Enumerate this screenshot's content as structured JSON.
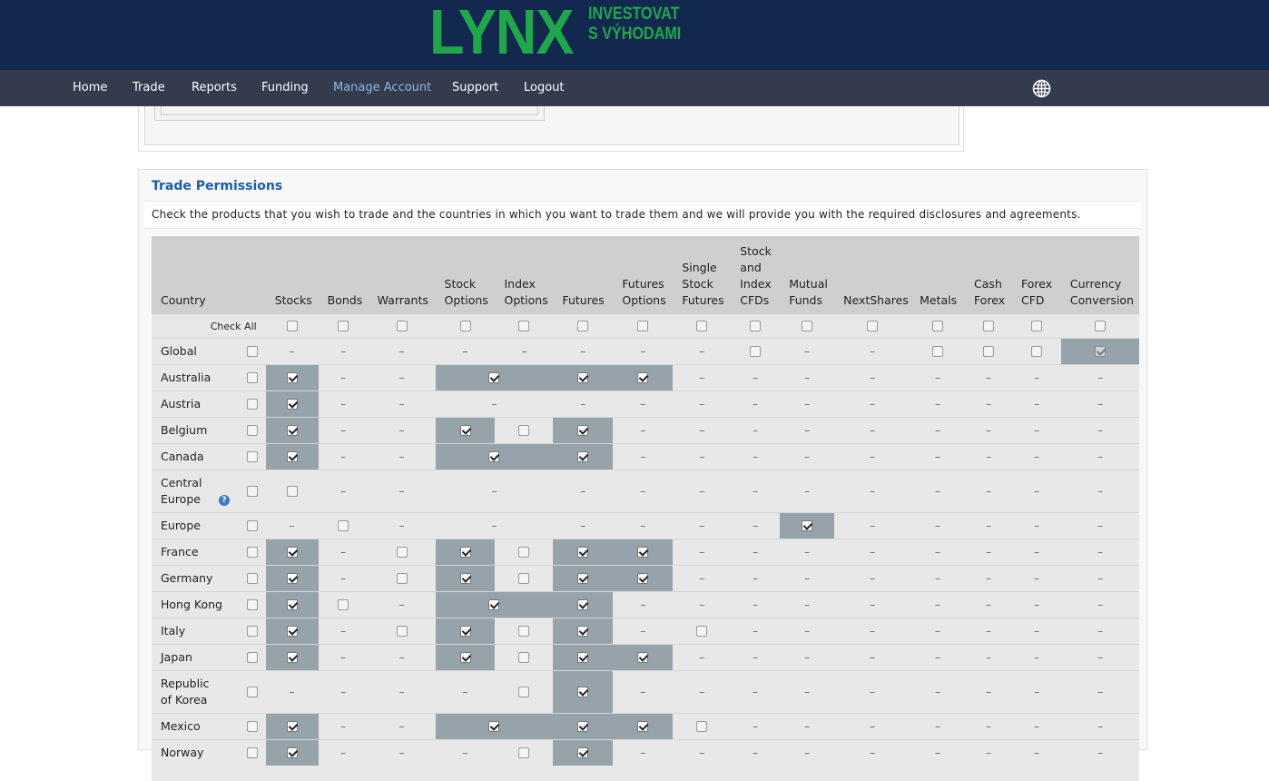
{
  "logo": {
    "mark": "LYNX",
    "tagline_line1": "INVESTOVAT",
    "tagline_line2": "S VÝHODAMI"
  },
  "nav": {
    "items": [
      "Home",
      "Trade",
      "Reports",
      "Funding",
      "Manage Account",
      "Support",
      "Logout"
    ],
    "active": "Manage Account"
  },
  "trade_permissions": {
    "title": "Trade Permissions",
    "description": "Check the products that you wish to trade and the countries in which you want to trade them and we will provide you with the required disclosures and agreements.",
    "columns": [
      {
        "key": "country",
        "label": [
          "Country"
        ]
      },
      {
        "key": "stocks",
        "label": [
          "Stocks"
        ]
      },
      {
        "key": "bonds",
        "label": [
          "Bonds"
        ]
      },
      {
        "key": "warrants",
        "label": [
          "Warrants"
        ]
      },
      {
        "key": "stock_options",
        "label": [
          "Stock",
          "Options"
        ]
      },
      {
        "key": "index_options",
        "label": [
          "Index",
          "Options"
        ]
      },
      {
        "key": "futures",
        "label": [
          "Futures"
        ]
      },
      {
        "key": "futures_options",
        "label": [
          "Futures",
          "Options"
        ]
      },
      {
        "key": "ssf",
        "label": [
          "Single",
          "Stock",
          "Futures"
        ]
      },
      {
        "key": "cfds",
        "label": [
          "Stock",
          "and",
          "Index",
          "CFDs"
        ]
      },
      {
        "key": "mutual_funds",
        "label": [
          "Mutual",
          "Funds"
        ]
      },
      {
        "key": "nextshares",
        "label": [
          "NextShares"
        ]
      },
      {
        "key": "metals",
        "label": [
          "Metals"
        ]
      },
      {
        "key": "cash_forex",
        "label": [
          "Cash",
          "Forex"
        ]
      },
      {
        "key": "forex_cfd",
        "label": [
          "Forex",
          "CFD"
        ]
      },
      {
        "key": "currency_conversion",
        "label": [
          "Currency",
          "Conversion"
        ]
      }
    ],
    "check_all_label": "Check All",
    "dash": "–",
    "rows": [
      {
        "country": "Global",
        "cells": [
          "–",
          "–",
          "–",
          "–",
          "–",
          "–",
          "–",
          "–",
          "u",
          "–",
          "–",
          "u",
          "u",
          "u",
          "D"
        ]
      },
      {
        "country": "Australia",
        "cells": [
          "C",
          "–",
          "–",
          "C",
          "",
          "C",
          "C",
          "–",
          "–",
          "–",
          "–",
          "–",
          "–",
          "–",
          "–"
        ],
        "spans": {
          "3": 2
        }
      },
      {
        "country": "Austria",
        "cells": [
          "C",
          "–",
          "–",
          "–",
          "",
          "–",
          "–",
          "–",
          "–",
          "–",
          "–",
          "–",
          "–",
          "–",
          "–"
        ],
        "spans": {
          "3": 2
        }
      },
      {
        "country": "Belgium",
        "cells": [
          "C",
          "–",
          "–",
          "C",
          "u",
          "C",
          "–",
          "–",
          "–",
          "–",
          "–",
          "–",
          "–",
          "–",
          "–"
        ]
      },
      {
        "country": "Canada",
        "cells": [
          "C",
          "–",
          "–",
          "C",
          "",
          "C",
          "–",
          "–",
          "–",
          "–",
          "–",
          "–",
          "–",
          "–",
          "–"
        ],
        "spans": {
          "3": 2
        }
      },
      {
        "country": "Central Europe",
        "tall": true,
        "help": true,
        "cells": [
          "u",
          "–",
          "–",
          "–",
          "",
          "–",
          "–",
          "–",
          "–",
          "–",
          "–",
          "–",
          "–",
          "–",
          "–"
        ],
        "spans": {
          "3": 2
        }
      },
      {
        "country": "Europe",
        "cells": [
          "–",
          "u",
          "–",
          "–",
          "",
          "–",
          "–",
          "–",
          "–",
          "C",
          "–",
          "–",
          "–",
          "–",
          "–"
        ],
        "spans": {
          "3": 2
        }
      },
      {
        "country": "France",
        "cells": [
          "C",
          "–",
          "u",
          "C",
          "u",
          "C",
          "C",
          "–",
          "–",
          "–",
          "–",
          "–",
          "–",
          "–",
          "–"
        ]
      },
      {
        "country": "Germany",
        "cells": [
          "C",
          "–",
          "u",
          "C",
          "u",
          "C",
          "C",
          "–",
          "–",
          "–",
          "–",
          "–",
          "–",
          "–",
          "–"
        ]
      },
      {
        "country": "Hong Kong",
        "cells": [
          "C",
          "u",
          "–",
          "C",
          "",
          "C",
          "–",
          "–",
          "–",
          "–",
          "–",
          "–",
          "–",
          "–",
          "–"
        ],
        "spans": {
          "3": 2
        }
      },
      {
        "country": "Italy",
        "cells": [
          "C",
          "–",
          "u",
          "C",
          "u",
          "C",
          "–",
          "u",
          "–",
          "–",
          "–",
          "–",
          "–",
          "–",
          "–"
        ]
      },
      {
        "country": "Japan",
        "cells": [
          "C",
          "–",
          "–",
          "C",
          "u",
          "C",
          "C",
          "–",
          "–",
          "–",
          "–",
          "–",
          "–",
          "–",
          "–"
        ]
      },
      {
        "country": "Republic of Korea",
        "tall": true,
        "cells": [
          "–",
          "–",
          "–",
          "–",
          "u",
          "C",
          "–",
          "–",
          "–",
          "–",
          "–",
          "–",
          "–",
          "–",
          "–"
        ]
      },
      {
        "country": "Mexico",
        "cells": [
          "C",
          "–",
          "–",
          "C",
          "",
          "C",
          "C",
          "u",
          "–",
          "–",
          "–",
          "–",
          "–",
          "–",
          "–"
        ],
        "spans": {
          "3": 2
        }
      },
      {
        "country": "Norway",
        "cells": [
          "C",
          "–",
          "–",
          "–",
          "u",
          "C",
          "–",
          "–",
          "–",
          "–",
          "–",
          "–",
          "–",
          "–",
          "–"
        ]
      }
    ],
    "highlight": {
      "Global": [
        14
      ],
      "Australia": [
        0,
        3,
        5,
        6
      ],
      "Austria": [
        0
      ],
      "Belgium": [
        0,
        3,
        5
      ],
      "Canada": [
        0,
        3,
        5
      ],
      "Europe": [
        9
      ],
      "France": [
        0,
        3,
        5,
        6
      ],
      "Germany": [
        0,
        3,
        5,
        6
      ],
      "Hong Kong": [
        0,
        3,
        5
      ],
      "Italy": [
        0,
        3,
        5
      ],
      "Japan": [
        0,
        3,
        5,
        6
      ],
      "Republic of Korea": [
        5
      ],
      "Mexico": [
        0,
        3,
        5,
        6
      ],
      "Norway": [
        0,
        5
      ]
    }
  },
  "colors": {
    "header_bg": "#13284f",
    "nav_bg": "#343b4d",
    "logo_green": "#1ea84a",
    "highlight": "#96a3ab",
    "title_blue": "#1b5ea8"
  },
  "icons": {
    "globe": "globe-icon",
    "help": "help-icon"
  }
}
